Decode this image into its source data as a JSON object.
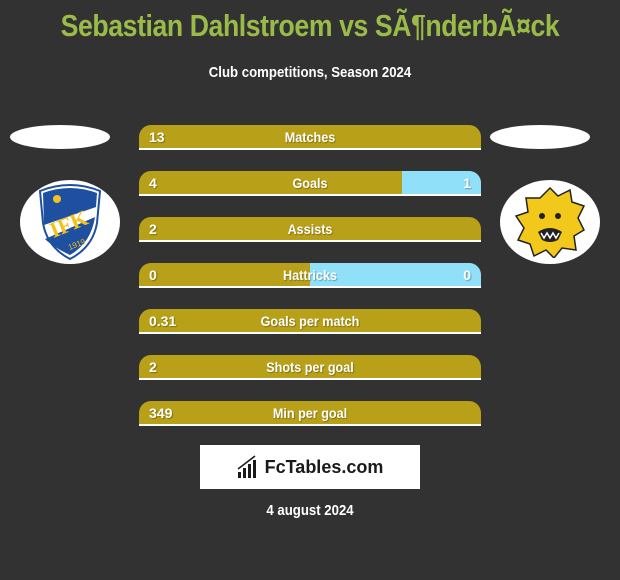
{
  "header": {
    "title": "Sebastian Dahlstroem vs SÃ¶nderbÃ¤ck",
    "subtitle": "Club competitions, Season 2024"
  },
  "teams": {
    "left": {
      "logo": "ifk-mariehamn-crest-icon",
      "logo_text": "IFK",
      "logo_year": "1919"
    },
    "right": {
      "logo": "lion-head-crest-icon"
    }
  },
  "colors": {
    "left_bar": "#b8a118",
    "right_bar": "#91e0f9",
    "title": "#9bbb48",
    "background": "#323232"
  },
  "stats": [
    {
      "label": "Matches",
      "left": "13",
      "right": "",
      "right_share": 0
    },
    {
      "label": "Goals",
      "left": "4",
      "right": "1",
      "right_share": 0.23
    },
    {
      "label": "Assists",
      "left": "2",
      "right": "",
      "right_share": 0
    },
    {
      "label": "Hattricks",
      "left": "0",
      "right": "0",
      "right_share": 0.5
    },
    {
      "label": "Goals per match",
      "left": "0.31",
      "right": "",
      "right_share": 0
    },
    {
      "label": "Shots per goal",
      "left": "2",
      "right": "",
      "right_share": 0
    },
    {
      "label": "Min per goal",
      "left": "349",
      "right": "",
      "right_share": 0
    }
  ],
  "branding": {
    "text": "FcTables.com"
  },
  "footer": {
    "date": "4 august 2024"
  }
}
